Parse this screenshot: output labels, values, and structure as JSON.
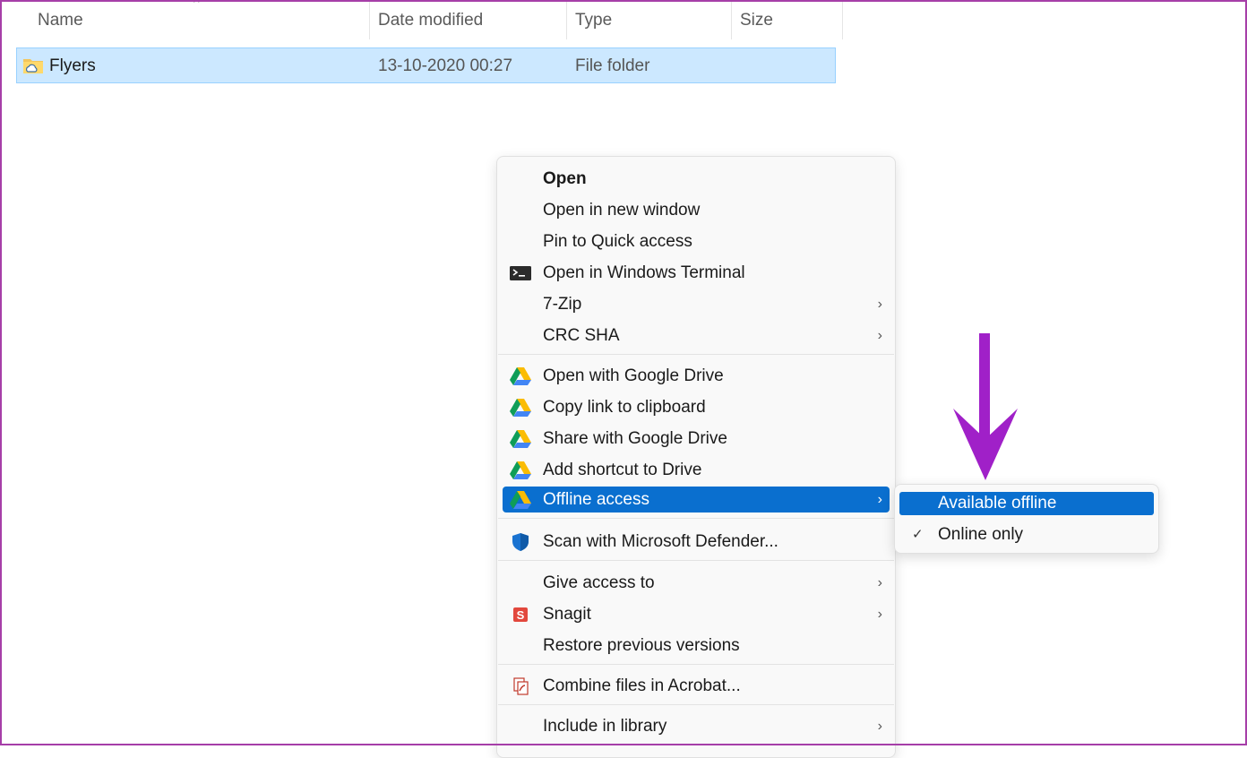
{
  "columns": {
    "name": "Name",
    "date_modified": "Date modified",
    "type": "Type",
    "size": "Size"
  },
  "file": {
    "name": "Flyers",
    "date_modified": "13-10-2020 00:27",
    "type": "File folder",
    "icon": "folder-cloud-icon"
  },
  "menu": {
    "open": "Open",
    "open_new_window": "Open in new window",
    "pin_quick_access": "Pin to Quick access",
    "open_terminal": "Open in Windows Terminal",
    "seven_zip": "7-Zip",
    "crc_sha": "CRC SHA",
    "open_google_drive": "Open with Google Drive",
    "copy_link": "Copy link to clipboard",
    "share_google_drive": "Share with Google Drive",
    "add_shortcut": "Add shortcut to Drive",
    "offline_access": "Offline access",
    "scan_defender": "Scan with Microsoft Defender...",
    "give_access": "Give access to",
    "snagit": "Snagit",
    "restore_versions": "Restore previous versions",
    "combine_acrobat": "Combine files in Acrobat...",
    "include_library": "Include in library"
  },
  "submenu": {
    "available_offline": "Available offline",
    "online_only": "Online only"
  },
  "colors": {
    "highlight": "#0a6fcf",
    "selection": "#cce8ff",
    "arrow": "#a020c8",
    "frame": "#a63ea8"
  }
}
